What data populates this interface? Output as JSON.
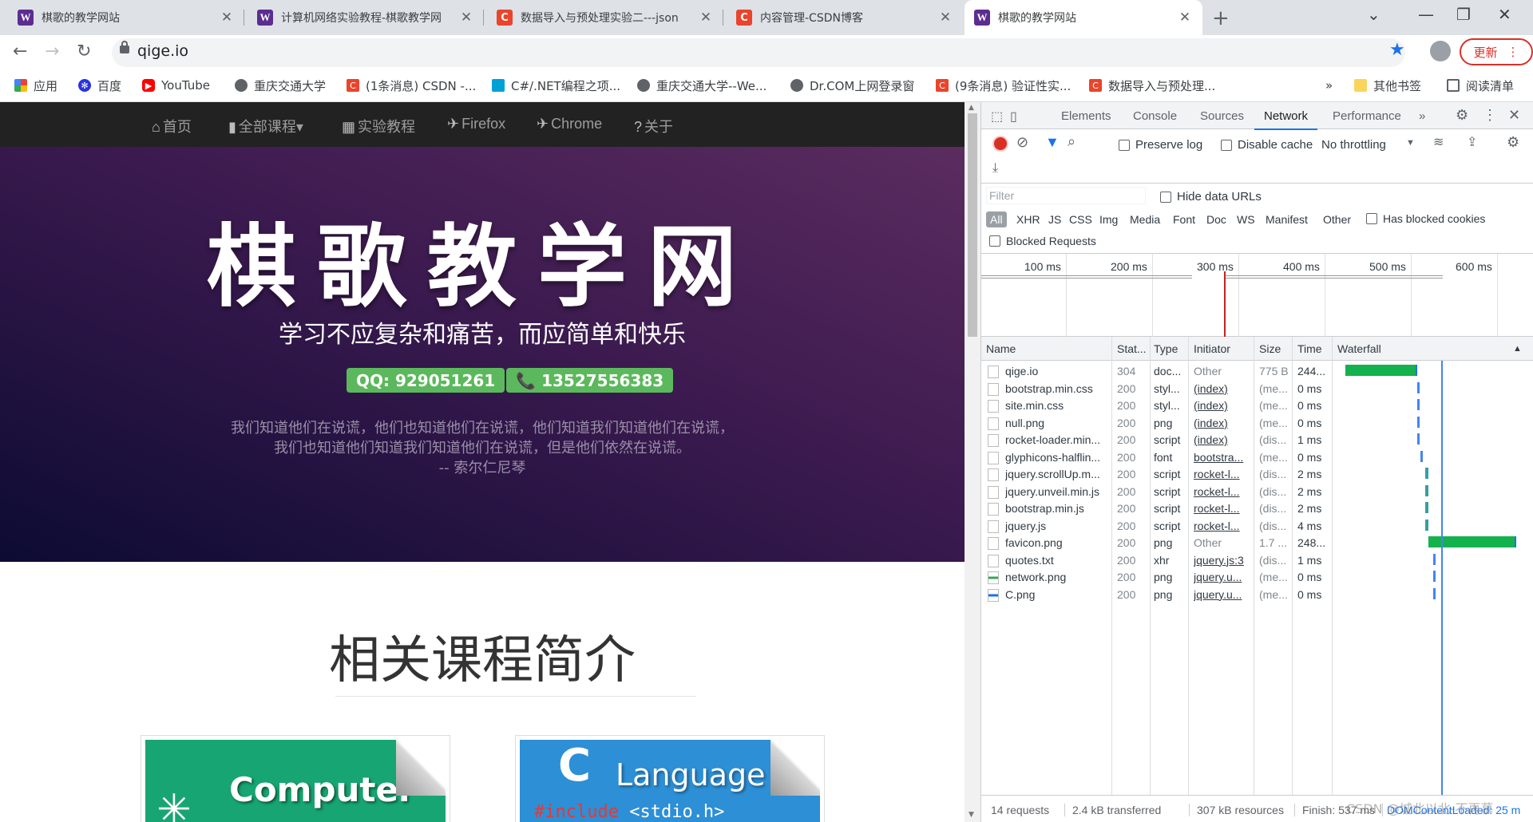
{
  "tabs": [
    {
      "favicon": "W",
      "title": "棋歌的教学网站"
    },
    {
      "favicon": "W",
      "title": "计算机网络实验教程-棋歌教学网"
    },
    {
      "favicon": "C",
      "title": "数据导入与预处理实验二---json"
    },
    {
      "favicon": "C",
      "title": "内容管理-CSDN博客"
    },
    {
      "favicon": "W",
      "title": "棋歌的教学网站"
    }
  ],
  "addressbar": {
    "url": "qige.io",
    "update_label": "更新"
  },
  "bookmarks": [
    {
      "label": "应用",
      "icon": "apps-grid-icon"
    },
    {
      "label": "百度",
      "icon": "baidu-paw-icon"
    },
    {
      "label": "YouTube",
      "icon": "youtube-icon"
    },
    {
      "label": "重庆交通大学",
      "icon": "globe-icon"
    },
    {
      "label": "(1条消息) CSDN -...",
      "icon": "csdn-icon"
    },
    {
      "label": "C#/.NET编程之项...",
      "icon": "bilibili-tv-icon"
    },
    {
      "label": "重庆交通大学--We...",
      "icon": "globe-icon"
    },
    {
      "label": "Dr.COM上网登录窗",
      "icon": "globe-icon"
    },
    {
      "label": "(9条消息) 验证性实...",
      "icon": "csdn-icon"
    },
    {
      "label": "数据导入与预处理...",
      "icon": "csdn-icon"
    }
  ],
  "bookmarks_more": "»",
  "bookmarks_other": "其他书签",
  "bookmarks_reading": "阅读清单",
  "site": {
    "nav": [
      {
        "label": "首页",
        "glyph": "⌂"
      },
      {
        "label": "全部课程▾",
        "glyph": "▮"
      },
      {
        "label": "实验教程",
        "glyph": "▦"
      },
      {
        "label": "Firefox",
        "glyph": "✈"
      },
      {
        "label": "Chrome",
        "glyph": "✈"
      },
      {
        "label": "关于",
        "glyph": "?"
      }
    ],
    "hero_title": "棋歌教学网",
    "hero_subtitle": "学习不应复杂和痛苦，而应简单和快乐",
    "qq_badge": "QQ: 929051261",
    "phone_badge": "📞 13527556383",
    "quote_line1": "我们知道他们在说谎，他们也知道他们在说谎，他们知道我们知道他们在说谎，",
    "quote_line2": "我们也知道他们知道我们知道他们在说谎，但是他们依然在说谎。",
    "quote_author": "-- 索尔仁尼琴",
    "section_title": "相关课程简介",
    "card1_title": "Computer",
    "card2_c": "C",
    "card2_title": "Language",
    "card2_code_kw": "#include",
    "card2_code_rest": " <stdio.h>"
  },
  "devtools": {
    "tabs": [
      "Elements",
      "Console",
      "Sources",
      "Network",
      "Performance"
    ],
    "active_tab": "Network",
    "more_tabs": "»",
    "preserve_log": "Preserve log",
    "disable_cache": "Disable cache",
    "throttling": "No throttling",
    "filter_placeholder": "Filter",
    "hide_data_urls": "Hide data URLs",
    "type_filters": [
      "All",
      "XHR",
      "JS",
      "CSS",
      "Img",
      "Media",
      "Font",
      "Doc",
      "WS",
      "Manifest",
      "Other"
    ],
    "has_blocked_cookies": "Has blocked cookies",
    "blocked_requests": "Blocked Requests",
    "overview_ticks": [
      "100 ms",
      "200 ms",
      "300 ms",
      "400 ms",
      "500 ms",
      "600 ms"
    ],
    "columns": [
      "Name",
      "Stat...",
      "Type",
      "Initiator",
      "Size",
      "Time",
      "Waterfall"
    ],
    "rows": [
      {
        "name": "qige.io",
        "status": "304",
        "type": "doc...",
        "initiator": "Other",
        "size": "775 B",
        "time": "244..."
      },
      {
        "name": "bootstrap.min.css",
        "status": "200",
        "type": "styl...",
        "initiator": "(index)",
        "size": "(me...",
        "time": "0 ms"
      },
      {
        "name": "site.min.css",
        "status": "200",
        "type": "styl...",
        "initiator": "(index)",
        "size": "(me...",
        "time": "0 ms"
      },
      {
        "name": "null.png",
        "status": "200",
        "type": "png",
        "initiator": "(index)",
        "size": "(me...",
        "time": "0 ms"
      },
      {
        "name": "rocket-loader.min...",
        "status": "200",
        "type": "script",
        "initiator": "(index)",
        "size": "(dis...",
        "time": "1 ms"
      },
      {
        "name": "glyphicons-halflin...",
        "status": "200",
        "type": "font",
        "initiator": "bootstra...",
        "size": "(me...",
        "time": "0 ms"
      },
      {
        "name": "jquery.scrollUp.m...",
        "status": "200",
        "type": "script",
        "initiator": "rocket-l...",
        "size": "(dis...",
        "time": "2 ms"
      },
      {
        "name": "jquery.unveil.min.js",
        "status": "200",
        "type": "script",
        "initiator": "rocket-l...",
        "size": "(dis...",
        "time": "2 ms"
      },
      {
        "name": "bootstrap.min.js",
        "status": "200",
        "type": "script",
        "initiator": "rocket-l...",
        "size": "(dis...",
        "time": "2 ms"
      },
      {
        "name": "jquery.js",
        "status": "200",
        "type": "script",
        "initiator": "rocket-l...",
        "size": "(dis...",
        "time": "4 ms"
      },
      {
        "name": "favicon.png",
        "status": "200",
        "type": "png",
        "initiator": "Other",
        "size": "1.7 ...",
        "time": "248..."
      },
      {
        "name": "quotes.txt",
        "status": "200",
        "type": "xhr",
        "initiator": "jquery.js:3",
        "size": "(dis...",
        "time": "1 ms"
      },
      {
        "name": "network.png",
        "status": "200",
        "type": "png",
        "initiator": "jquery.u...",
        "size": "(me...",
        "time": "0 ms"
      },
      {
        "name": "C.png",
        "status": "200",
        "type": "png",
        "initiator": "jquery.u...",
        "size": "(me...",
        "time": "0 ms"
      }
    ],
    "status_requests": "14 requests",
    "status_transferred": "2.4 kB transferred",
    "status_resources": "307 kB resources",
    "status_finish": "Finish: 537 ms",
    "status_dcl": "DOMContentLoaded: 25 m"
  },
  "watermark": "CSDN @城北以北-不再慕"
}
